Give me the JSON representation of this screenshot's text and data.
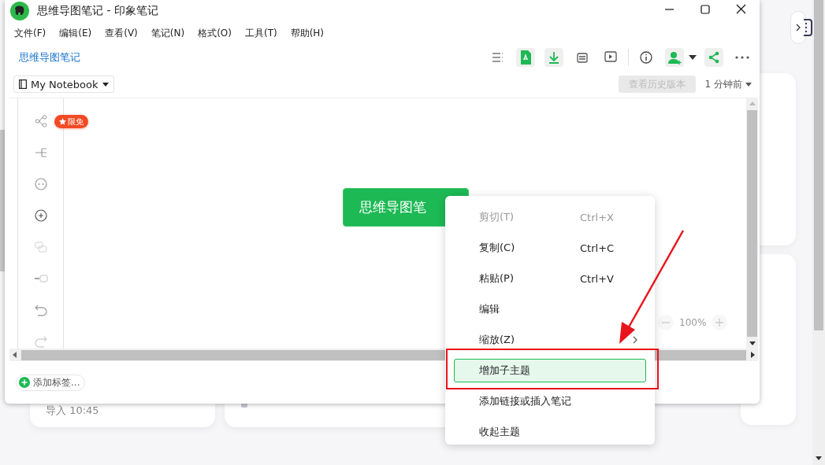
{
  "window": {
    "title": "思维导图笔记 - 印象笔记"
  },
  "menu_bar": [
    "文件(F)",
    "编辑(E)",
    "查看(V)",
    "笔记(N)",
    "格式(O)",
    "工具(T)",
    "帮助(H)"
  ],
  "breadcrumb": "思维导图笔记",
  "notebook": {
    "label": "My Notebook"
  },
  "history_button": {
    "label": "查看历史版本",
    "disabled": true
  },
  "saved_time": "1 分钟前",
  "badge": "限免",
  "mind_map": {
    "root": "思维导图笔"
  },
  "zoom": {
    "reading": "100%"
  },
  "tag_button": "添加标签...",
  "context_menu": [
    {
      "label": "剪切(T)",
      "shortcut": "Ctrl+X",
      "disabled": true,
      "selected": false,
      "submenu": false
    },
    {
      "label": "复制(C)",
      "shortcut": "Ctrl+C",
      "disabled": false,
      "selected": false,
      "submenu": false
    },
    {
      "label": "粘贴(P)",
      "shortcut": "Ctrl+V",
      "disabled": false,
      "selected": false,
      "submenu": false
    },
    {
      "label": "编辑",
      "disabled": false,
      "selected": false,
      "submenu": false
    },
    {
      "label": "缩放(Z)",
      "disabled": false,
      "selected": false,
      "submenu": true
    },
    {
      "label": "增加子主题",
      "disabled": false,
      "selected": true,
      "submenu": false
    },
    {
      "label": "添加链接或插入笔记",
      "disabled": false,
      "selected": false,
      "submenu": false
    },
    {
      "label": "收起主题",
      "disabled": false,
      "selected": false,
      "submenu": false
    }
  ],
  "background_cards": [
    {
      "text": "导入 10:45"
    }
  ]
}
